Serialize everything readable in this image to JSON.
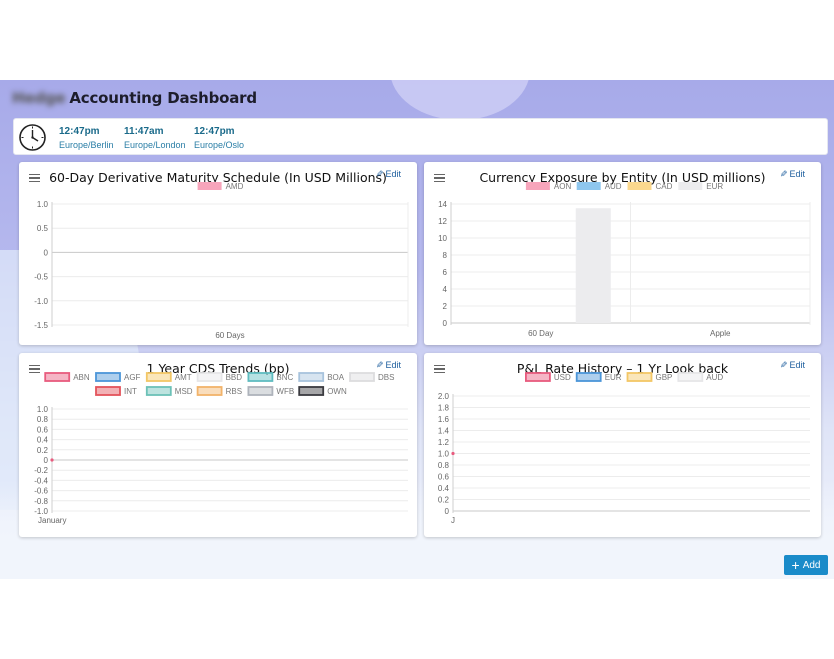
{
  "header": {
    "title_blurred": "Hedge",
    "title": "Accounting Dashboard"
  },
  "clocks": [
    {
      "time": "12:47pm",
      "zone": "Europe/Berlin"
    },
    {
      "time": "11:47am",
      "zone": "Europe/London"
    },
    {
      "time": "12:47pm",
      "zone": "Europe/Oslo"
    }
  ],
  "panels": {
    "p1": {
      "title": "60-Day Derivative Maturity Schedule (In USD Millions)",
      "edit": "Edit"
    },
    "p2": {
      "title": "Currency Exposure by Entity (In USD millions)",
      "edit": "Edit"
    },
    "p3": {
      "title": "1 Year CDS Trends (bp)",
      "edit": "Edit"
    },
    "p4": {
      "title": "P&L Rate History – 1 Yr Look back",
      "edit": "Edit"
    }
  },
  "add_button": "Add",
  "colors": {
    "accent": "#1a8bc9",
    "link": "#1f5f9e",
    "time": "#1a6a8a"
  },
  "chart_data": [
    {
      "type": "bar",
      "title": "60-Day Derivative Maturity Schedule (In USD Millions)",
      "categories": [
        "60 Days"
      ],
      "series": [
        {
          "name": "AMD",
          "values": [],
          "color": "#f7a5bb"
        }
      ],
      "yticks": [
        "1.0",
        "0.5",
        "0",
        "-0.5",
        "-1.0",
        "-1.5"
      ],
      "ylim": [
        -1.5,
        1.0
      ],
      "legend": "top",
      "grid": true
    },
    {
      "type": "bar",
      "title": "Currency Exposure by Entity (In USD millions)",
      "categories": [
        "60 Day",
        "Apple"
      ],
      "series": [
        {
          "name": "AON",
          "values": [
            0,
            0
          ],
          "color": "#f7a5bb"
        },
        {
          "name": "AUD",
          "values": [
            0,
            0
          ],
          "color": "#8ec6ee"
        },
        {
          "name": "CAD",
          "values": [
            0,
            0
          ],
          "color": "#fbd88e"
        },
        {
          "name": "EUR",
          "values": [
            13.5,
            0
          ],
          "color": "#ececee"
        }
      ],
      "yticks": [
        "14",
        "12",
        "10",
        "8",
        "6",
        "4",
        "2",
        "0"
      ],
      "ylim": [
        0,
        14
      ],
      "legend": "top",
      "grid": true
    },
    {
      "type": "line",
      "title": "1 Year CDS Trends (bp)",
      "categories": [
        "January"
      ],
      "series": [
        {
          "name": "ABN",
          "values": [
            0
          ],
          "color": "#e85b7e"
        },
        {
          "name": "AGF",
          "values": [],
          "color": "#4b95d8"
        },
        {
          "name": "AMT",
          "values": [],
          "color": "#f3c766"
        },
        {
          "name": "BBD",
          "values": [],
          "color": "#e6e6e8"
        },
        {
          "name": "BNC",
          "values": [],
          "color": "#5fbcc0"
        },
        {
          "name": "BOA",
          "values": [],
          "color": "#a7c3dd"
        },
        {
          "name": "DBS",
          "values": [],
          "color": "#dcdcde"
        },
        {
          "name": "INT",
          "values": [],
          "color": "#e3535b"
        },
        {
          "name": "MSD",
          "values": [],
          "color": "#6cc1b7"
        },
        {
          "name": "RBS",
          "values": [],
          "color": "#f2b36a"
        },
        {
          "name": "WFB",
          "values": [],
          "color": "#aeb3bb"
        },
        {
          "name": "OWN",
          "values": [],
          "color": "#3a3a3f"
        }
      ],
      "yticks": [
        "1.0",
        "0.8",
        "0.6",
        "0.4",
        "0.2",
        "0",
        "-0.2",
        "-0.4",
        "-0.6",
        "-0.8",
        "-1.0"
      ],
      "ylim": [
        -1.0,
        1.0
      ],
      "legend": "top",
      "grid": true
    },
    {
      "type": "line",
      "title": "P&L Rate History – 1 Yr Look back",
      "categories": [
        "J"
      ],
      "series": [
        {
          "name": "USD",
          "values": [
            1.0
          ],
          "color": "#e85b7e"
        },
        {
          "name": "EUR",
          "values": [],
          "color": "#4b95d8"
        },
        {
          "name": "GBP",
          "values": [],
          "color": "#f3c766"
        },
        {
          "name": "AUD",
          "values": [],
          "color": "#e6e6e8"
        }
      ],
      "yticks": [
        "2.0",
        "1.8",
        "1.6",
        "1.4",
        "1.2",
        "1.0",
        "0.8",
        "0.6",
        "0.4",
        "0.2",
        "0"
      ],
      "ylim": [
        0,
        2.0
      ],
      "legend": "top",
      "grid": true
    }
  ]
}
